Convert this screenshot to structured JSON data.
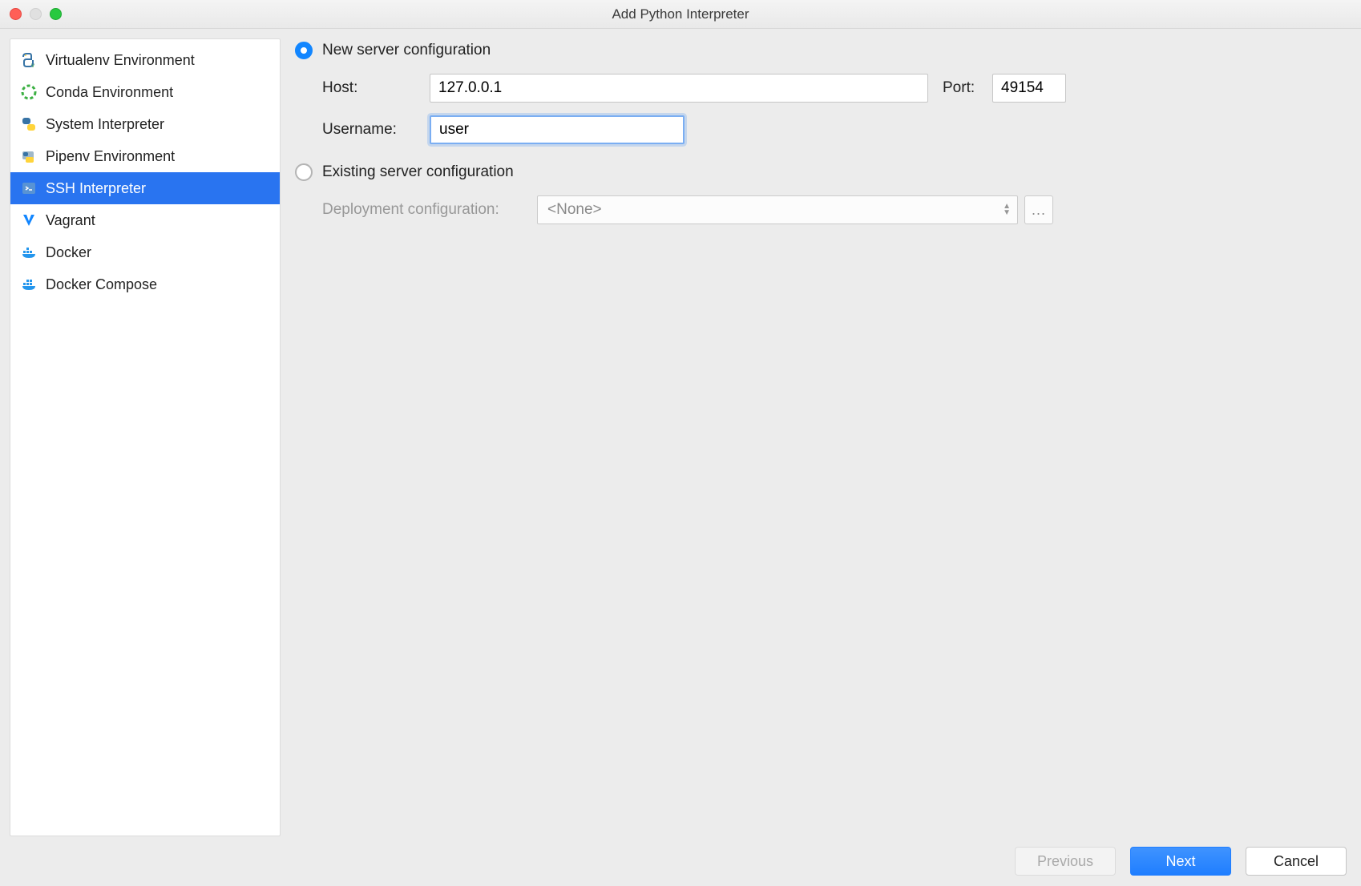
{
  "window": {
    "title": "Add Python Interpreter"
  },
  "sidebar": {
    "items": [
      {
        "label": "Virtualenv Environment",
        "icon": "python-venv-icon"
      },
      {
        "label": "Conda Environment",
        "icon": "conda-icon"
      },
      {
        "label": "System Interpreter",
        "icon": "python-icon"
      },
      {
        "label": "Pipenv Environment",
        "icon": "pipenv-icon"
      },
      {
        "label": "SSH Interpreter",
        "icon": "terminal-icon",
        "selected": true
      },
      {
        "label": "Vagrant",
        "icon": "vagrant-icon"
      },
      {
        "label": "Docker",
        "icon": "docker-icon"
      },
      {
        "label": "Docker Compose",
        "icon": "docker-compose-icon"
      }
    ]
  },
  "form": {
    "new_config_label": "New server configuration",
    "host_label": "Host:",
    "host_value": "127.0.0.1",
    "port_label": "Port:",
    "port_value": "49154",
    "username_label": "Username:",
    "username_value": "user",
    "existing_config_label": "Existing server configuration",
    "deploy_label": "Deployment configuration:",
    "deploy_value": "<None>",
    "browse_label": "..."
  },
  "buttons": {
    "previous": "Previous",
    "next": "Next",
    "cancel": "Cancel"
  }
}
